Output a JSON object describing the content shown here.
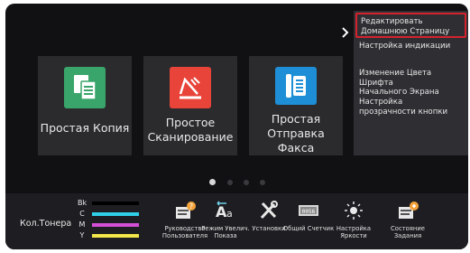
{
  "home": {
    "tiles": [
      {
        "label": "Простая Копия",
        "icon": "copy-icon",
        "color": "#3aa56a"
      },
      {
        "label": "Простое\nСканирование",
        "icon": "scan-icon",
        "color": "#e8443a"
      },
      {
        "label": "Простая\nОтправка Факса",
        "icon": "fax-icon",
        "color": "#1e8fd6"
      }
    ],
    "page_indicator": {
      "total": 4,
      "current": 1
    }
  },
  "menu": {
    "items": [
      "Редактировать\nДомашнюю Страницу",
      "Настройка индикации",
      "Изменение Цвета Шрифта\nНачального Экрана",
      "Настройка\nпрозрачности кнопки"
    ],
    "highlight_color": "#d4232e"
  },
  "bottom_bar": {
    "toner_label": "Кол.Тонера",
    "toner": [
      {
        "channel": "Bk",
        "color": "#000000"
      },
      {
        "channel": "C",
        "color": "#2fd0e8"
      },
      {
        "channel": "M",
        "color": "#d24fd6"
      },
      {
        "channel": "Y",
        "color": "#f2e64a"
      }
    ],
    "functions": [
      {
        "label": "Руководство\nПользователя",
        "icon": "user-guide-icon"
      },
      {
        "label": "Режим Увелич.\nПоказа",
        "icon": "enlarge-display-icon"
      },
      {
        "label": "Установки",
        "icon": "settings-icon"
      },
      {
        "label": "Общий Счетчик",
        "icon": "total-counter-icon"
      },
      {
        "label": "Настройка\nЯркости",
        "icon": "brightness-icon"
      },
      {
        "label": "Состояние\nЗадания",
        "icon": "job-status-icon"
      }
    ]
  }
}
